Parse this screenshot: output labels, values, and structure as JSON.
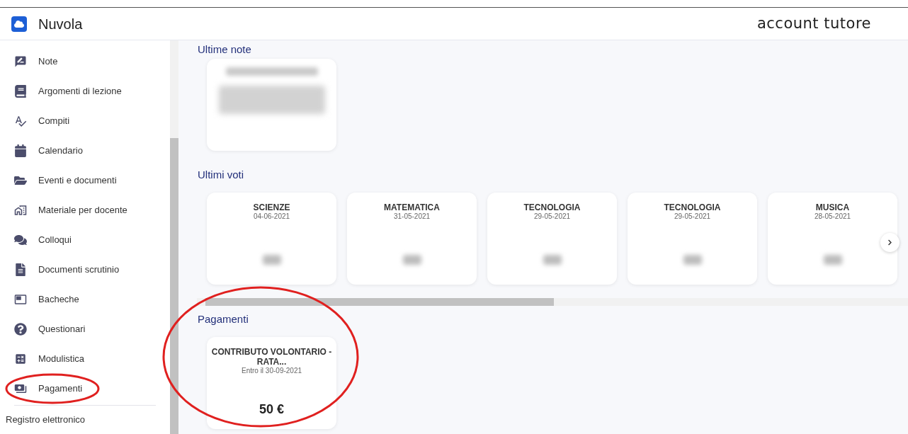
{
  "header": {
    "app_name": "Nuvola",
    "account": "account tutore"
  },
  "sidebar": {
    "items": [
      {
        "label": "Note"
      },
      {
        "label": "Argomenti di lezione"
      },
      {
        "label": "Compiti"
      },
      {
        "label": "Calendario"
      },
      {
        "label": "Eventi e documenti"
      },
      {
        "label": "Materiale per docente"
      },
      {
        "label": "Colloqui"
      },
      {
        "label": "Documenti scrutinio"
      },
      {
        "label": "Bacheche"
      },
      {
        "label": "Questionari"
      },
      {
        "label": "Modulistica"
      },
      {
        "label": "Pagamenti"
      }
    ],
    "footer": "Registro elettronico"
  },
  "notes": {
    "heading": "Ultime note"
  },
  "grades": {
    "heading": "Ultimi voti",
    "cards": [
      {
        "subject": "SCIENZE",
        "date": "04-06-2021"
      },
      {
        "subject": "MATEMATICA",
        "date": "31-05-2021"
      },
      {
        "subject": "TECNOLOGIA",
        "date": "29-05-2021"
      },
      {
        "subject": "TECNOLOGIA",
        "date": "29-05-2021"
      },
      {
        "subject": "MUSICA",
        "date": "28-05-2021"
      }
    ]
  },
  "payments": {
    "heading": "Pagamenti",
    "cards": [
      {
        "title": "CONTRIBUTO VOLONTARIO - RATA...",
        "due": "Entro il 30-09-2021",
        "amount": "50 €"
      }
    ]
  }
}
